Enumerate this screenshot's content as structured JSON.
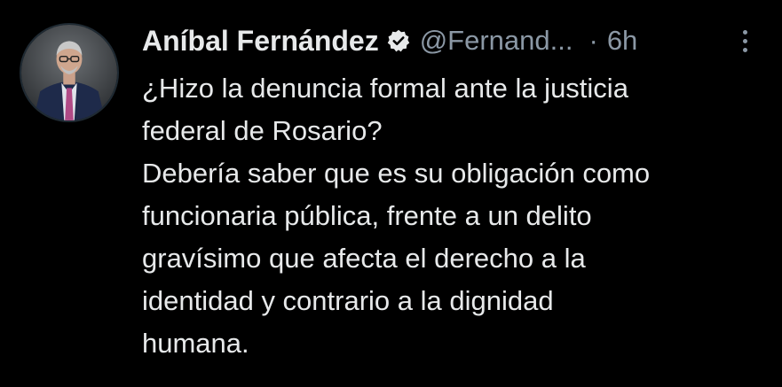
{
  "tweet": {
    "author_name": "Aníbal Fernández",
    "handle": "@Fernand...",
    "separator": "·",
    "time": "6h",
    "body_lines": [
      "¿Hizo la denuncia formal ante la justicia",
      "federal de Rosario?",
      "Debería saber que es su obligación como",
      "funcionaria pública, frente a un delito",
      "gravísimo que afecta el derecho a la",
      "identidad y contrario a la dignidad",
      "humana."
    ]
  },
  "icons": {
    "verified": "verified-badge-icon",
    "more": "more-options-icon"
  },
  "colors": {
    "background": "#000000",
    "text": "#e7e9ea",
    "secondary_text": "#8b98a5",
    "verified_badge": "#e7e9ea"
  }
}
